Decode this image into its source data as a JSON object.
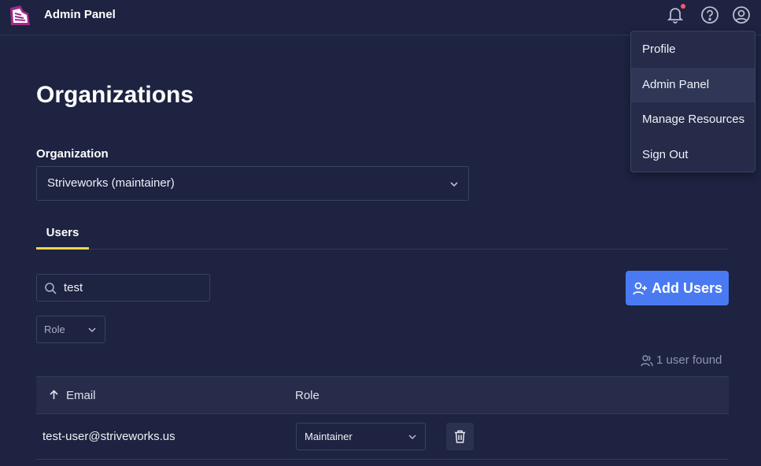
{
  "header": {
    "app_title": "Admin Panel",
    "icons": [
      "logo-icon",
      "bell-icon",
      "help-icon",
      "user-circle-icon"
    ],
    "notification_color": "#ff5a6a"
  },
  "user_menu": {
    "items": [
      {
        "label": "Profile"
      },
      {
        "label": "Admin Panel",
        "active": true
      },
      {
        "label": "Manage Resources"
      },
      {
        "label": "Sign Out"
      }
    ]
  },
  "main": {
    "page_title": "Organizations",
    "org_field_label": "Organization",
    "org_selected": "Striveworks (maintainer)",
    "tabs": [
      {
        "label": "Users",
        "active": true
      }
    ],
    "search_value": "test",
    "add_users_label": "Add Users",
    "role_filter_label": "Role",
    "result_count": "1 user found"
  },
  "table": {
    "columns": [
      "Email",
      "Role"
    ],
    "rows": [
      {
        "email": "test-user@striveworks.us",
        "role": "Maintainer"
      }
    ]
  },
  "colors": {
    "background": "#1d2340",
    "accent": "#4a7af2",
    "tab_indicator": "#f4d64b"
  }
}
